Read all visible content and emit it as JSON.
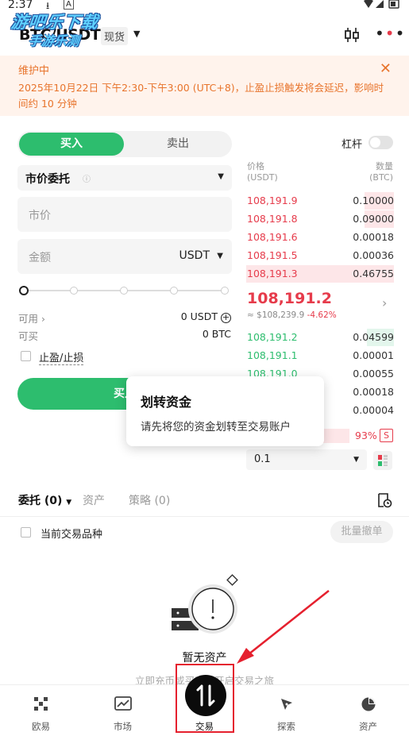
{
  "status_bar": {
    "time": "2:37"
  },
  "watermark": {
    "line1": "游吧乐下载",
    "line2": "手游乐测"
  },
  "header": {
    "pair": "BTC/USDT",
    "market_type": "现货"
  },
  "banner": {
    "title": "维护中",
    "message": "2025年10月22日 下午2:30-下午3:00 (UTC+8)，止盈止损触发将会延迟，影响时间约 10 分钟"
  },
  "trade_form": {
    "buy_tab": "买入",
    "sell_tab": "卖出",
    "order_type": "市价委托",
    "price_placeholder": "市价",
    "amount_placeholder": "金额",
    "amount_unit": "USDT",
    "available_label": "可用",
    "available_value": "0 USDT",
    "can_buy_label": "可买",
    "can_buy_value": "0 BTC",
    "tpsl_label": "止盈/止损",
    "submit_label": "买入",
    "slider_percent": 0
  },
  "tooltip": {
    "title": "划转资金",
    "description": "请先将您的资金划转至交易账户"
  },
  "leverage": {
    "label": "杠杆",
    "enabled": false
  },
  "order_book": {
    "price_header": "价格",
    "price_unit": "(USDT)",
    "qty_header": "数量",
    "qty_unit": "(BTC)",
    "asks": [
      {
        "price": "108,191.9",
        "qty": "0.10000",
        "depth": 0.2
      },
      {
        "price": "108,191.8",
        "qty": "0.09000",
        "depth": 0.2
      },
      {
        "price": "108,191.6",
        "qty": "0.00018",
        "depth": 0
      },
      {
        "price": "108,191.5",
        "qty": "0.00036",
        "depth": 0
      },
      {
        "price": "108,191.3",
        "qty": "0.46755",
        "depth": 1.0
      }
    ],
    "mid_price": "108,191.2",
    "mid_usd": "≈ $108,239.9",
    "mid_change": "-4.62%",
    "bids": [
      {
        "price": "108,191.2",
        "qty": "0.04599",
        "depth": 0.1
      },
      {
        "price": "108,191.1",
        "qty": "0.00001",
        "depth": 0
      },
      {
        "price": "108,191.0",
        "qty": "0.00055",
        "depth": 0
      },
      {
        "price": "",
        "qty": "0.00018",
        "depth": 0
      },
      {
        "price": "",
        "qty": "0.00004",
        "depth": 0
      }
    ],
    "ratio": "93%",
    "ratio_side": "S",
    "depth_step": "0.1"
  },
  "orders": {
    "tabs": [
      "委托 (0)",
      "资产",
      "策略 (0)"
    ],
    "current_pair_label": "当前交易品种",
    "batch_cancel": "批量撤单",
    "empty_title": "暂无资产",
    "empty_subtitle": "立即充币或买币，开启交易之旅"
  },
  "nav": {
    "items": [
      {
        "label": "欧易",
        "icon": "okx-logo-icon"
      },
      {
        "label": "市场",
        "icon": "market-chart-icon"
      },
      {
        "label": "交易",
        "icon": "trade-arrows-icon"
      },
      {
        "label": "探索",
        "icon": "explore-icon"
      },
      {
        "label": "资产",
        "icon": "assets-pie-icon"
      }
    ]
  },
  "colors": {
    "buy_green": "#2dbd6e",
    "sell_red": "#e63b4b",
    "banner_orange": "#e8742c",
    "annotation_red": "#e5202e"
  }
}
